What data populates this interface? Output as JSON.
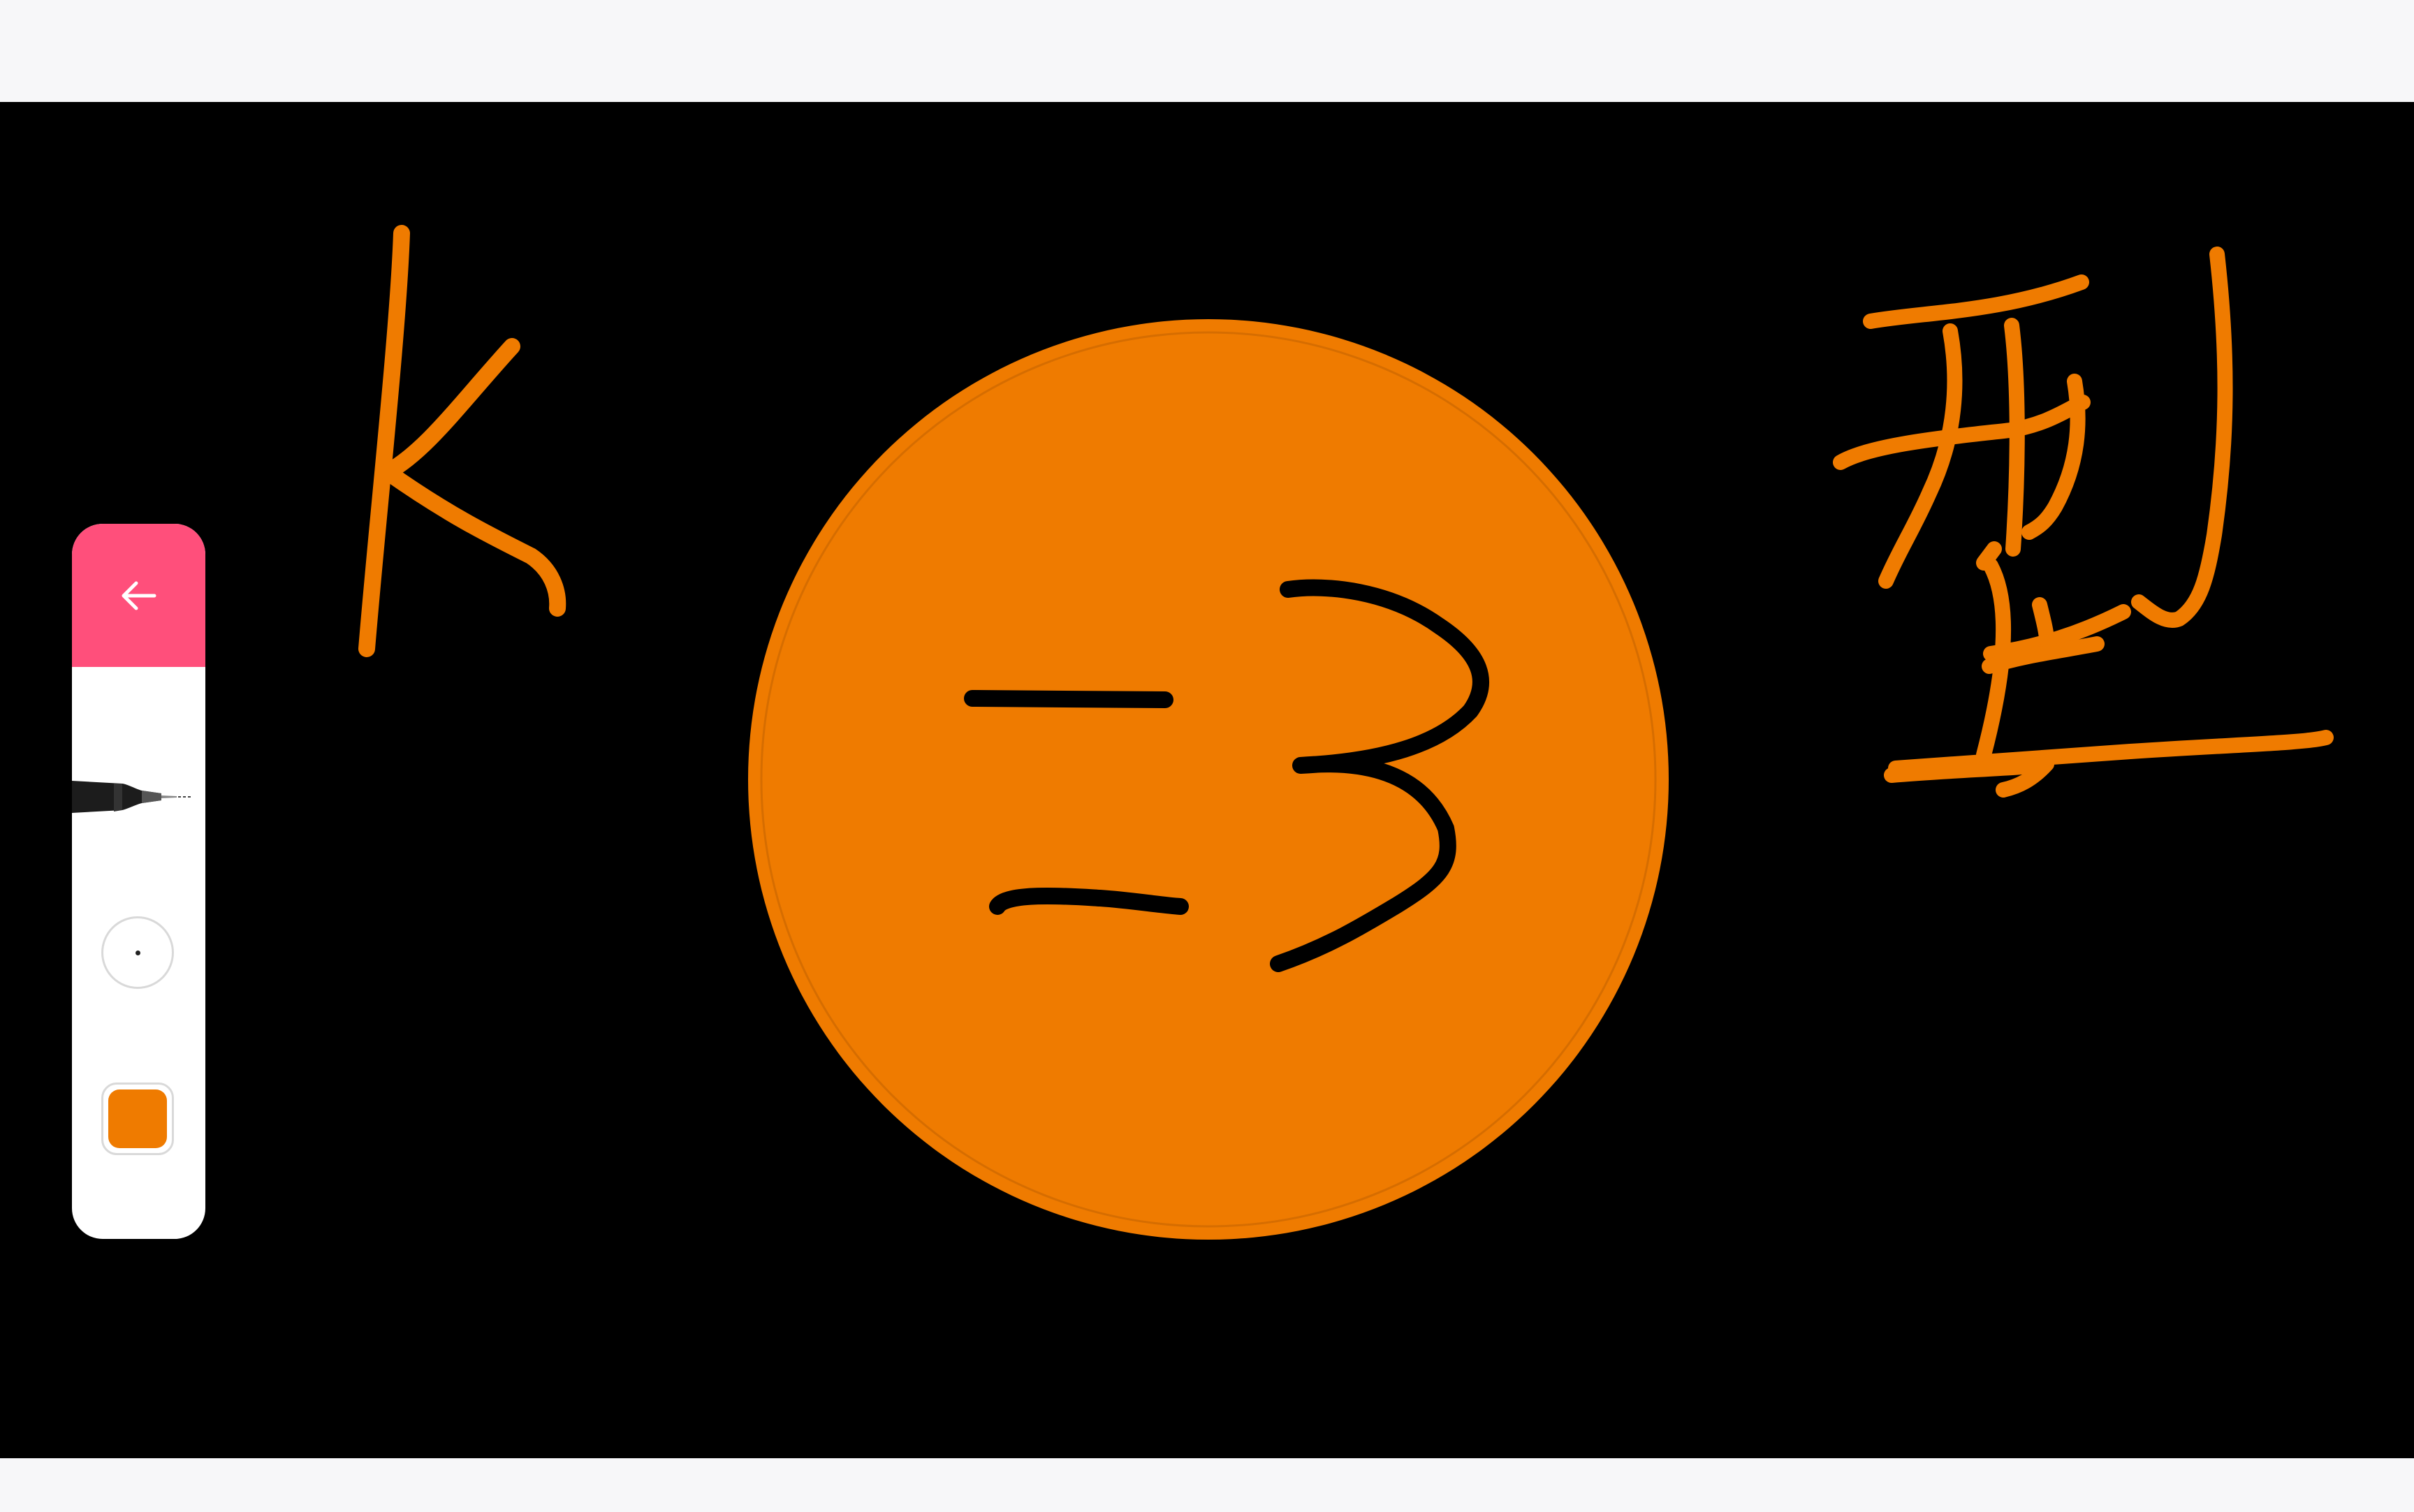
{
  "colors": {
    "canvas_background": "#000000",
    "chrome_background": "#f7f7f9",
    "toolbar_header": "#ff4f7b",
    "drawing_orange": "#ef7b00",
    "drawing_black": "#000000"
  },
  "toolbar": {
    "back_icon": "arrow-left-icon",
    "pen_icon": "pen-icon",
    "brush_size_icon": "brush-size-icon",
    "selected_color": "#ef7b00"
  },
  "canvas": {
    "strokes": [
      "K",
      "3",
      "型"
    ]
  }
}
